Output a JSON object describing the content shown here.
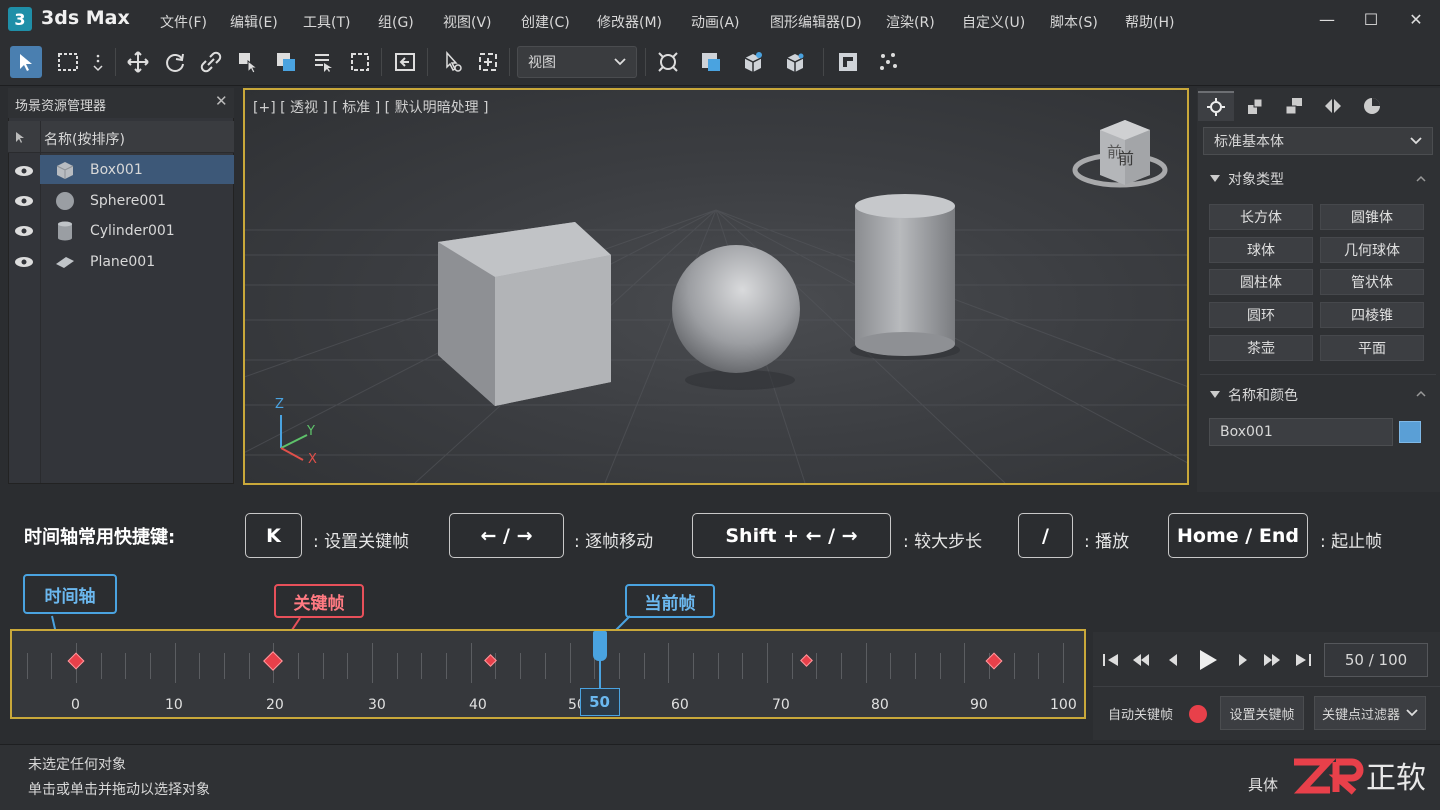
{
  "app": {
    "logo": "3",
    "title": "3ds Max"
  },
  "menu": [
    "文件(F)",
    "编辑(E)",
    "工具(T)",
    "组(G)",
    "视图(V)",
    "创建(C)",
    "修改器(M)",
    "动画(A)",
    "图形编辑器(D)",
    "渲染(R)",
    "自定义(U)",
    "脚本(S)",
    "帮助(H)"
  ],
  "window_controls": {
    "minimize": "—",
    "maximize": "☐",
    "close": "✕"
  },
  "toolbar": {
    "view_select": "视图",
    "active_tool": "select-object-icon"
  },
  "scene_explorer": {
    "title": "场景资源管理器",
    "close": "✕",
    "column_header": "名称(按排序)",
    "items": [
      {
        "name": "Box001",
        "icon": "box-icon",
        "selected": true
      },
      {
        "name": "Sphere001",
        "icon": "sphere-icon",
        "selected": false
      },
      {
        "name": "Cylinder001",
        "icon": "cylinder-icon",
        "selected": false
      },
      {
        "name": "Plane001",
        "icon": "plane-icon",
        "selected": false
      }
    ]
  },
  "viewport": {
    "label": "[+] [ 透视 ] [ 标准 ] [ 默认明暗处理 ]",
    "viewcube_face": "前",
    "viewcube_side": "前",
    "axis": {
      "z": "Z",
      "y": "Y",
      "x": "X"
    }
  },
  "command_panel": {
    "dropdown": "标准基本体",
    "section_object_type": "对象类型",
    "object_buttons": [
      "长方体",
      "圆锥体",
      "球体",
      "几何球体",
      "圆柱体",
      "管状体",
      "圆环",
      "四棱锥",
      "茶壶",
      "平面"
    ],
    "section_name_color": "名称和颜色",
    "name_value": "Box001",
    "object_color": "#5a9fd6"
  },
  "shortcuts": {
    "title": "时间轴常用快捷键:",
    "items": [
      {
        "key": "K",
        "desc": ": 设置关键帧"
      },
      {
        "key": "← / →",
        "desc": ": 逐帧移动"
      },
      {
        "key": "Shift + ← / →",
        "desc": ": 较大步长"
      },
      {
        "key": "/",
        "desc": ": 播放"
      },
      {
        "key": "Home / End",
        "desc": ": 起止帧"
      }
    ]
  },
  "timeline": {
    "callout_timeline": "时间轴",
    "callout_keyframe": "关键帧",
    "callout_current": "当前帧",
    "tick_labels": [
      "0",
      "10",
      "20",
      "30",
      "40",
      "50",
      "60",
      "70",
      "80",
      "90",
      "100"
    ],
    "current_frame": 50,
    "current_frame_label": "50",
    "keyframes": [
      0,
      20,
      42,
      74,
      93
    ],
    "highlight_color": "#c9a83a",
    "keyframe_color": "#e8404a",
    "current_color": "#4aa3e0"
  },
  "playback": {
    "frame_display": "50 / 100",
    "auto_key": "自动关键帧",
    "set_key": "设置关键帧",
    "key_filter": "关键点过滤器"
  },
  "status": {
    "line1": "未选定任何对象",
    "line2": "单击或单击并拖动以选择对象",
    "watermark_partial": "具体"
  }
}
